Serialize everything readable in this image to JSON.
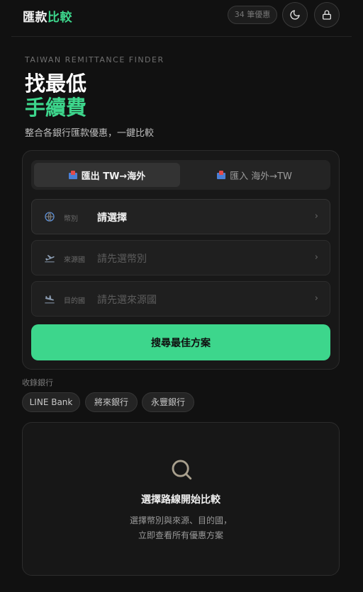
{
  "header": {
    "logo_part1": "匯款",
    "logo_part2": "比較",
    "count_badge": "34 筆優惠",
    "theme_icon": "moon-icon",
    "lock_icon": "lock-icon"
  },
  "hero": {
    "eyebrow": "TAIWAN REMITTANCE FINDER",
    "title_line1": "找最低",
    "title_line2": "手續費",
    "subtitle": "整合各銀行匯款優惠，一鍵比較"
  },
  "tabs": [
    {
      "label": "匯出 TW→海外",
      "icon": "flag-icon",
      "active": true
    },
    {
      "label": "匯入 海外→TW",
      "icon": "flag-icon",
      "active": false
    }
  ],
  "fields": {
    "currency": {
      "label": "幣別",
      "value": "請選擇",
      "icon": "globe-icon"
    },
    "source": {
      "label": "來源國",
      "value": "請先選幣別",
      "icon": "plane-departure-icon"
    },
    "destination": {
      "label": "目的國",
      "value": "請先選來源國",
      "icon": "plane-arrival-icon"
    }
  },
  "search_button": "搜尋最佳方案",
  "banks": {
    "label": "收錄銀行",
    "items": [
      "LINE Bank",
      "將來銀行",
      "永豐銀行"
    ]
  },
  "empty_state": {
    "icon": "search-icon",
    "title": "選擇路線開始比較",
    "desc_line1": "選擇幣別與來源、目的國，",
    "desc_line2": "立即查看所有優惠方案"
  },
  "colors": {
    "accent": "#3dd68c",
    "background": "#111111"
  }
}
